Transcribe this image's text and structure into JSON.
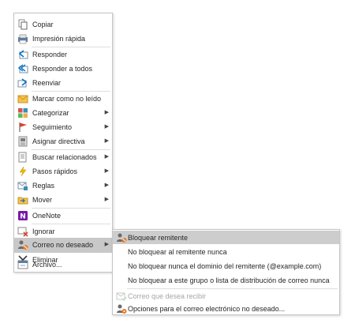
{
  "context_menu": {
    "items": [
      {
        "label": "Copiar",
        "icon": "copy-icon"
      },
      {
        "label": "Impresión rápida",
        "icon": "quick-print-icon"
      },
      {
        "label": "Responder",
        "icon": "reply-icon"
      },
      {
        "label": "Responder a todos",
        "icon": "reply-all-icon"
      },
      {
        "label": "Reenviar",
        "icon": "forward-icon"
      },
      {
        "label": "Marcar como no leído",
        "icon": "mark-unread-icon"
      },
      {
        "label": "Categorizar",
        "icon": "categorize-icon"
      },
      {
        "label": "Seguimiento",
        "icon": "flag-icon"
      },
      {
        "label": "Asignar directiva",
        "icon": "policy-icon"
      },
      {
        "label": "Buscar relacionados",
        "icon": "find-related-icon"
      },
      {
        "label": "Pasos rápidos",
        "icon": "quick-steps-icon"
      },
      {
        "label": "Reglas",
        "icon": "rules-icon"
      },
      {
        "label": "Mover",
        "icon": "move-icon"
      },
      {
        "label": "OneNote",
        "icon": "onenote-icon"
      },
      {
        "label": "Ignorar",
        "icon": "ignore-icon"
      },
      {
        "label": "Correo no deseado",
        "icon": "junk-mail-icon"
      },
      {
        "label": "Eliminar",
        "icon": "delete-icon"
      },
      {
        "label": "Archivo...",
        "icon": "archive-icon"
      }
    ]
  },
  "junk_submenu": {
    "items": [
      {
        "label": "Bloquear remitente",
        "icon": "block-sender-icon"
      },
      {
        "label": "No bloquear al remitente nunca"
      },
      {
        "label": "No bloquear nunca el dominio del remitente (@example.com)"
      },
      {
        "label": "No bloquear a este grupo o lista de distribución de correo nunca"
      },
      {
        "label": "Correo que desea recibir",
        "icon": "safe-mail-icon"
      },
      {
        "label": "Opciones para el correo electrónico no deseado...",
        "icon": "junk-options-icon"
      }
    ]
  },
  "colors": {
    "highlight": "#c8c8c8",
    "border": "#c6c6c6",
    "accent_outlook": "#0072c6",
    "onenote": "#7719aa"
  }
}
